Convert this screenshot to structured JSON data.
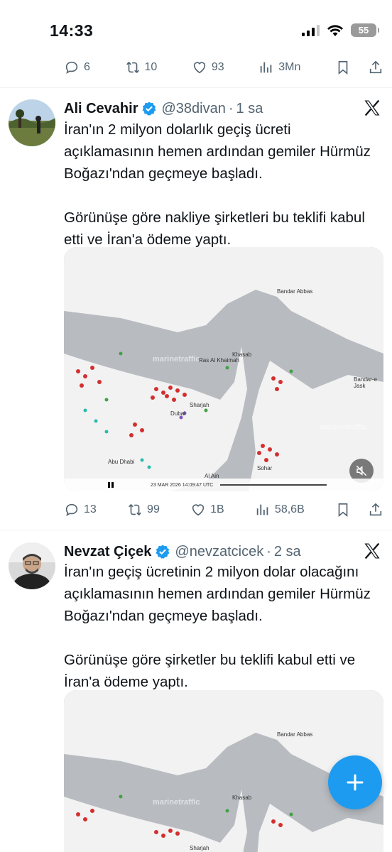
{
  "status_bar": {
    "time": "14:33",
    "battery": "55"
  },
  "prev_tweet_actions": {
    "replies": "6",
    "retweets": "10",
    "likes": "93",
    "views": "3Mn"
  },
  "tweets": [
    {
      "name": "Ali Cevahir",
      "handle": "@38divan",
      "sep": "·",
      "time": "1 sa",
      "text": "İran'ın 2 milyon dolarlık geçiş ücreti açıklamasının hemen ardından gemiler Hürmüz Boğazı'ndan geçmeye başladı.\n\nGörünüşe göre nakliye şirketleri bu teklifi kabul etti ve İran'a ödeme yaptı.",
      "actions": {
        "replies": "13",
        "retweets": "99",
        "likes": "1B",
        "views": "58,6B"
      },
      "media": {
        "watermark": "marinetraffic",
        "timestamp": "23 MAR 2026 14:09:47 UTC",
        "cities": [
          "Bandar Abbas",
          "Khasab",
          "Ras Al Khaimah",
          "Sharjah",
          "Dubai",
          "Abu Dhabi",
          "Al Ain",
          "Sohar",
          "Bandar-e Jask"
        ]
      }
    },
    {
      "name": "Nevzat Çiçek",
      "handle": "@nevzatcicek",
      "sep": "·",
      "time": "2 sa",
      "text": "İran'ın geçiş ücretinin 2 milyon dolar olacağını açıklamasının hemen ardından gemiler Hürmüz Boğazı'ndan geçmeye başladı.\n\nGörünüşe göre şirketler bu teklifi kabul etti ve İran'a ödeme yaptı.",
      "media": {
        "watermark": "marinetraffic",
        "cities": [
          "Bandar Abbas",
          "Khasab",
          "Sharjah"
        ]
      }
    }
  ],
  "colors": {
    "accent": "#1d9bf0",
    "muted": "#536471"
  },
  "icons": [
    "reply-icon",
    "retweet-icon",
    "like-icon",
    "views-icon",
    "bookmark-icon",
    "share-icon",
    "verified-icon",
    "x-logo-icon",
    "mute-icon",
    "compose-icon"
  ]
}
